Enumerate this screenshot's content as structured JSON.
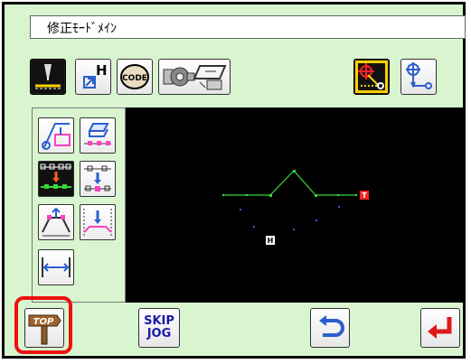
{
  "title": "修正ﾓｰﾄﾞﾒｲﾝ",
  "toolbar": {
    "code_label": "CODE",
    "h_label": "H"
  },
  "bottom": {
    "top_label": "TOP",
    "skip_label": "SKIP",
    "jog_label": "JOG"
  },
  "canvas": {
    "origin_marker": "H",
    "end_marker": "T"
  },
  "colors": {
    "line": "#38d838",
    "end_marker": "#ff2020",
    "accent_blue": "#2b5fcf",
    "highlight_red": "#ee1010"
  }
}
